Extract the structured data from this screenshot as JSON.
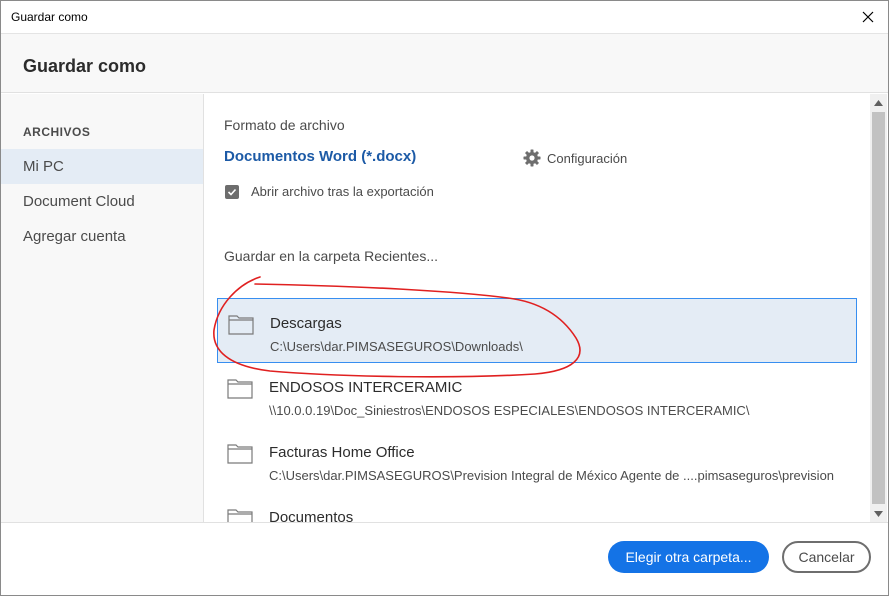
{
  "window": {
    "title": "Guardar como",
    "close_icon": "close-icon"
  },
  "header": {
    "heading": "Guardar como"
  },
  "sidebar": {
    "section_title": "ARCHIVOS",
    "items": [
      {
        "label": "Mi PC",
        "selected": true
      },
      {
        "label": "Document Cloud",
        "selected": false
      },
      {
        "label": "Agregar cuenta",
        "selected": false
      }
    ]
  },
  "content": {
    "format_label": "Formato de archivo",
    "format_value": "Documentos Word (*.docx)",
    "settings_label": "Configuración",
    "open_after_export": {
      "label": "Abrir archivo tras la exportación",
      "checked": true
    },
    "recent_label": "Guardar en la carpeta Recientes...",
    "folders": [
      {
        "name": "Descargas",
        "path": "C:\\Users\\dar.PIMSASEGUROS\\Downloads\\",
        "selected": true
      },
      {
        "name": "ENDOSOS INTERCERAMIC",
        "path": "\\\\10.0.0.19\\Doc_Siniestros\\ENDOSOS ESPECIALES\\ENDOSOS INTERCERAMIC\\",
        "selected": false
      },
      {
        "name": "Facturas Home Office",
        "path": "C:\\Users\\dar.PIMSASEGUROS\\Prevision Integral de México Agente de ....pimsaseguros\\prevision",
        "selected": false
      },
      {
        "name": "Documentos",
        "path": "",
        "selected": false
      }
    ]
  },
  "footer": {
    "choose_folder_label": "Elegir otra carpeta...",
    "cancel_label": "Cancelar"
  },
  "colors": {
    "accent": "#1473e6",
    "format_text": "#1c5aa6",
    "selected_bg": "#e4ecf5",
    "selected_border": "#378ef0",
    "annotation": "#e02020"
  }
}
